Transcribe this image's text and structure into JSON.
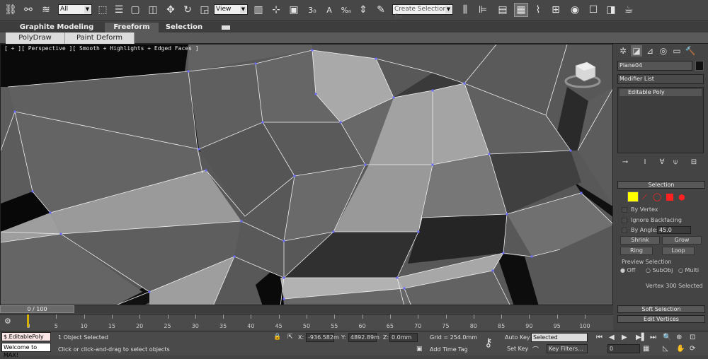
{
  "toolbar": {
    "filter_value": "All",
    "refcoord_value": "View",
    "named_selection_placeholder": "Create Selection Se",
    "snap_labels": {
      "snap3": "3",
      "angle": "A",
      "percent": "%"
    }
  },
  "ribbon": {
    "tabs": [
      "Graphite Modeling Tools",
      "Freeform",
      "Selection"
    ],
    "subtabs": [
      "PolyDraw",
      "Paint Deform"
    ]
  },
  "viewport": {
    "label": "[ + ][ Perspective ][ Smooth + Highlights + Edged Faces ]"
  },
  "command_panel": {
    "object_name": "Plane04",
    "modifier_list": "Modifier List",
    "stack_item": "Editable Poly",
    "selection_title": "Selection",
    "by_vertex": "By Vertex",
    "ignore_backfacing": "Ignore Backfacing",
    "by_angle": "By Angle:",
    "angle_value": "45.0",
    "shrink": "Shrink",
    "grow": "Grow",
    "ring": "Ring",
    "loop": "Loop",
    "preview_selection": "Preview Selection",
    "preview_off": "Off",
    "preview_subobj": "SubObj",
    "preview_multi": "Multi",
    "selected_info": "Vertex 300 Selected",
    "soft_selection": "Soft Selection",
    "edit_vertices": "Edit Vertices"
  },
  "timeline": {
    "frame_counter": "0 / 100",
    "ticks": [
      "0",
      "5",
      "10",
      "15",
      "20",
      "25",
      "30",
      "35",
      "40",
      "45",
      "50",
      "55",
      "60",
      "65",
      "70",
      "75",
      "80",
      "85",
      "90",
      "95",
      "100"
    ]
  },
  "status": {
    "maxscript_line1": "$.EditablePoly",
    "maxscript_line2": "Welcome to MAX!",
    "objects_selected": "1 Object Selected",
    "prompt": "Click or click-and-drag to select objects",
    "x_label": "X:",
    "x_value": "-936.582m",
    "y_label": "Y:",
    "y_value": "4892.89m",
    "z_label": "Z:",
    "z_value": "0.0mm",
    "grid": "Grid = 254.0mm",
    "add_time_tag": "Add Time Tag",
    "auto_key": "Auto Key",
    "set_key": "Set Key",
    "key_mode": "Selected",
    "key_filters": "Key Filters...",
    "current_frame": "0"
  },
  "colors": {
    "vertex_highlight": "#ffff00",
    "edge_red": "#ff2020"
  }
}
